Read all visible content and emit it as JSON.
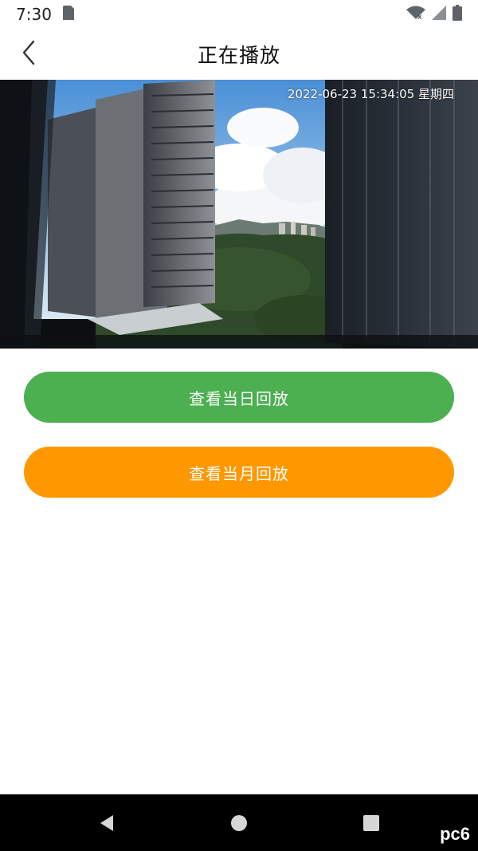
{
  "status_bar": {
    "time": "7:30",
    "icons": [
      "sd-card-icon",
      "wifi-x-icon",
      "signal-icon",
      "battery-icon"
    ]
  },
  "app_bar": {
    "title": "正在播放",
    "back_icon": "chevron-left-icon"
  },
  "video": {
    "timestamp": "2022-06-23 15:34:05 星期四"
  },
  "buttons": {
    "day_replay": "查看当日回放",
    "month_replay": "查看当月回放"
  },
  "nav_bar": {
    "icons": [
      "back-triangle-icon",
      "home-circle-icon",
      "recents-square-icon"
    ]
  },
  "colors": {
    "day_button": "#4caf50",
    "month_button": "#ff9800",
    "nav_background": "#000000"
  },
  "watermark": "pc6"
}
